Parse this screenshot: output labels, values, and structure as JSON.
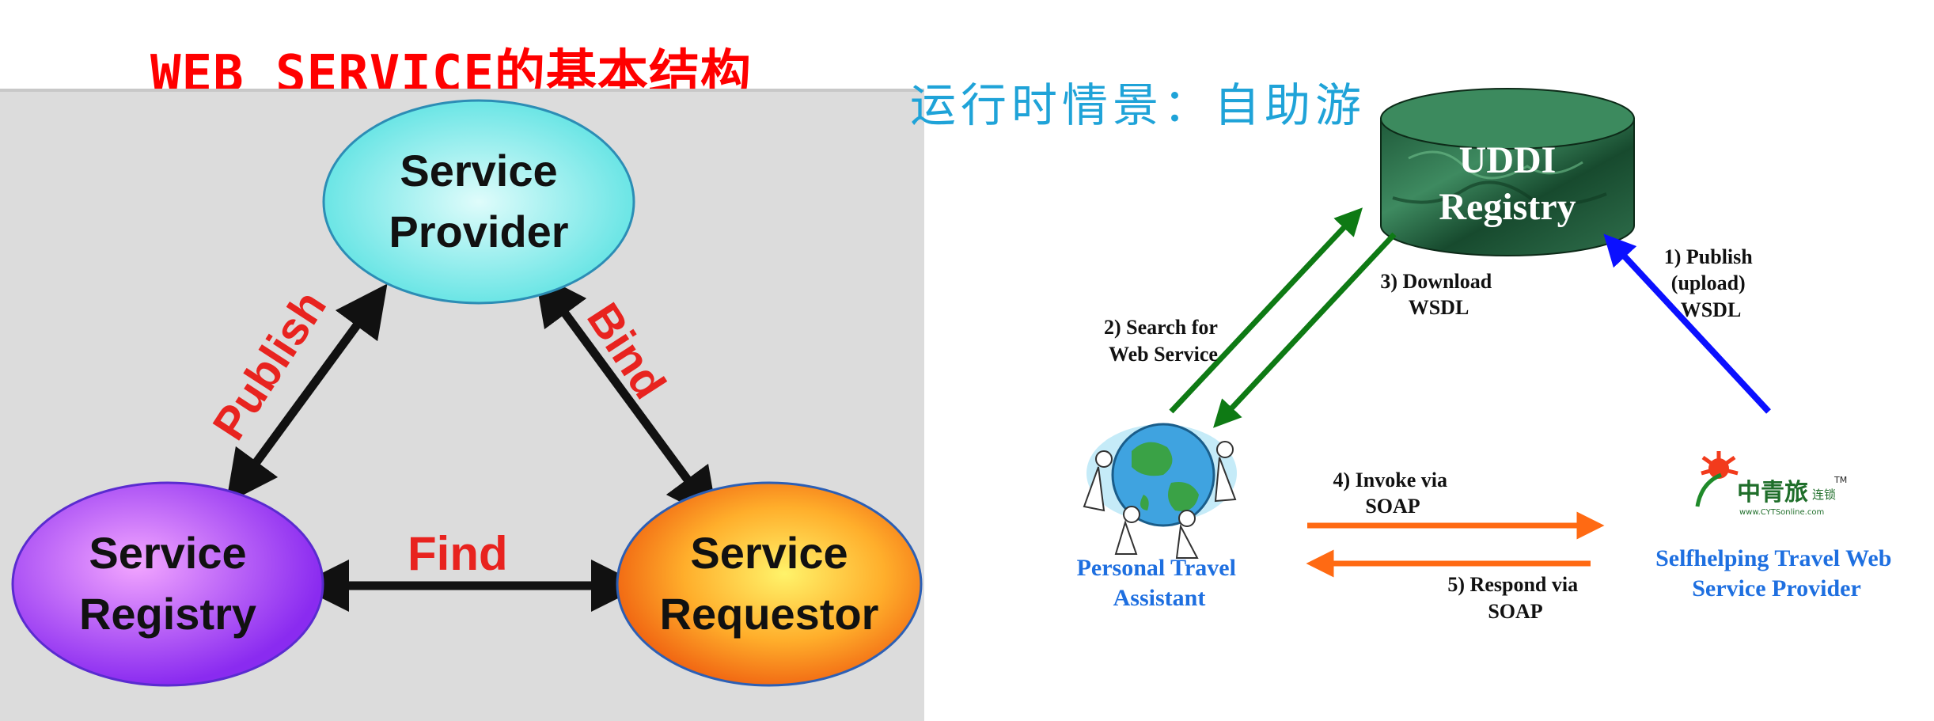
{
  "left": {
    "title": "WEB SERVICE的基本结构",
    "nodes": {
      "provider": [
        "Service",
        "Provider"
      ],
      "registry": [
        "Service",
        "Registry"
      ],
      "requestor": [
        "Service",
        "Requestor"
      ]
    },
    "relations": {
      "publish": "Publish",
      "bind": "Bind",
      "find": "Find"
    }
  },
  "right": {
    "title": "运行时情景：自助游",
    "uddi": [
      "UDDI",
      "Registry"
    ],
    "steps": {
      "publish": [
        "1) Publish",
        "(upload)",
        "WSDL"
      ],
      "search": [
        "2) Search for",
        "Web Service"
      ],
      "download": [
        "3) Download",
        "WSDL"
      ],
      "invoke": [
        "4) Invoke via",
        "SOAP"
      ],
      "respond": [
        "5) Respond via",
        "SOAP"
      ]
    },
    "assistant_label": [
      "Personal Travel",
      "Assistant"
    ],
    "provider_label": [
      "Selfhelping Travel Web",
      "Service Provider"
    ],
    "logo": {
      "name": "中青旅",
      "suffix": "连锁",
      "url": "www.CYTSonline.com",
      "tm": "TM"
    },
    "colors": {
      "publish_arrow": "#0b10ff",
      "search_arrow": "#0e7a14",
      "soap_arrow": "#ff6a13",
      "label_blue": "#1e6fe0"
    }
  }
}
